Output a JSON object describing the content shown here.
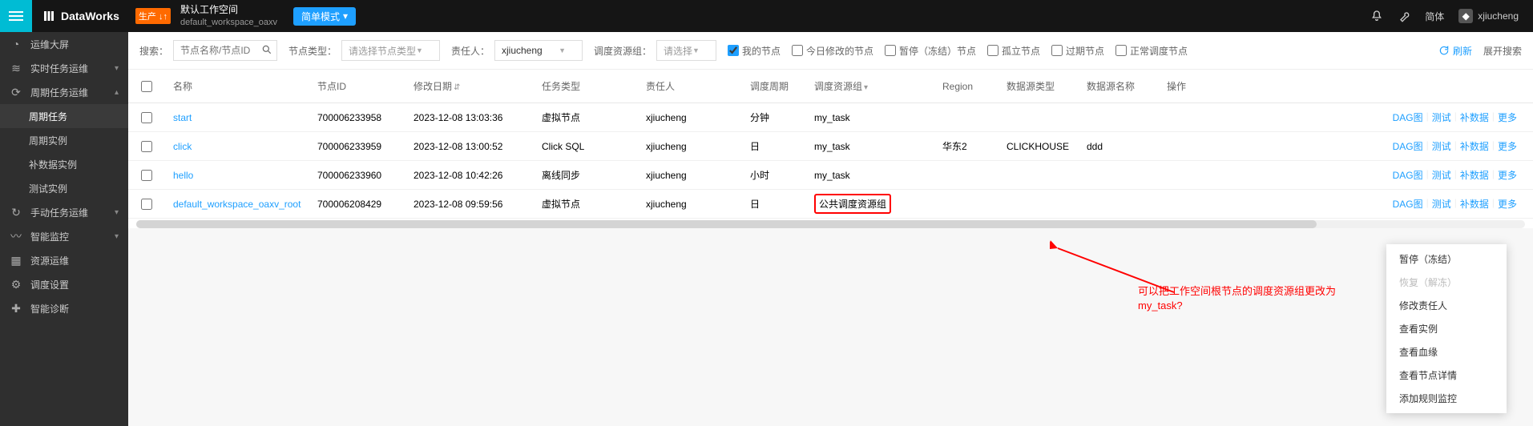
{
  "header": {
    "brand": "DataWorks",
    "prod_tag": "生产 ↓↑",
    "workspace_title": "默认工作空间",
    "workspace_sub": "default_workspace_oaxv",
    "mode_label": "简单模式",
    "lang_label": "简体",
    "username": "xjiucheng"
  },
  "sidebar": {
    "items": [
      {
        "icon": "dashboard",
        "label": "运维大屏",
        "chev": ""
      },
      {
        "icon": "realtime",
        "label": "实时任务运维",
        "chev": "down"
      },
      {
        "icon": "cycle",
        "label": "周期任务运维",
        "chev": "up"
      },
      {
        "icon": "",
        "label": "周期任务",
        "chev": "",
        "lv": 2,
        "active": true
      },
      {
        "icon": "",
        "label": "周期实例",
        "chev": "",
        "lv": 2
      },
      {
        "icon": "",
        "label": "补数据实例",
        "chev": "",
        "lv": 2
      },
      {
        "icon": "",
        "label": "测试实例",
        "chev": "",
        "lv": 2
      },
      {
        "icon": "manual",
        "label": "手动任务运维",
        "chev": "down"
      },
      {
        "icon": "monitor",
        "label": "智能监控",
        "chev": "down"
      },
      {
        "icon": "resource",
        "label": "资源运维",
        "chev": ""
      },
      {
        "icon": "settings",
        "label": "调度设置",
        "chev": ""
      },
      {
        "icon": "diagnose",
        "label": "智能诊断",
        "chev": ""
      }
    ]
  },
  "filter": {
    "search_label": "搜索：",
    "search_placeholder": "节点名称/节点ID",
    "node_type_label": "节点类型：",
    "node_type_placeholder": "请选择节点类型",
    "owner_label": "责任人：",
    "owner_value": "xjiucheng",
    "resgroup_label": "调度资源组：",
    "resgroup_placeholder": "请选择",
    "chk_mynode": "我的节点",
    "chk_today": "今日修改的节点",
    "chk_paused": "暂停（冻结）节点",
    "chk_isolated": "孤立节点",
    "chk_expired": "过期节点",
    "chk_normal": "正常调度节点",
    "refresh_label": "刷新",
    "expand_label": "展开搜索"
  },
  "table": {
    "headers": {
      "name": "名称",
      "id": "节点ID",
      "date": "修改日期",
      "type": "任务类型",
      "owner": "责任人",
      "cycle": "调度周期",
      "group": "调度资源组",
      "region": "Region",
      "dstype": "数据源类型",
      "dsname": "数据源名称",
      "ops": "操作"
    },
    "rows": [
      {
        "name": "start",
        "id": "700006233958",
        "date": "2023-12-08 13:03:36",
        "type": "虚拟节点",
        "owner": "xjiucheng",
        "cycle": "分钟",
        "group": "my_task",
        "region": "",
        "dstype": "",
        "dsname": ""
      },
      {
        "name": "click",
        "id": "700006233959",
        "date": "2023-12-08 13:00:52",
        "type": "Click SQL",
        "owner": "xjiucheng",
        "cycle": "日",
        "group": "my_task",
        "region": "华东2",
        "dstype": "CLICKHOUSE",
        "dsname": "ddd"
      },
      {
        "name": "hello",
        "id": "700006233960",
        "date": "2023-12-08 10:42:26",
        "type": "离线同步",
        "owner": "xjiucheng",
        "cycle": "小时",
        "group": "my_task",
        "region": "",
        "dstype": "",
        "dsname": ""
      },
      {
        "name": "default_workspace_oaxv_root",
        "id": "700006208429",
        "date": "2023-12-08 09:59:56",
        "type": "虚拟节点",
        "owner": "xjiucheng",
        "cycle": "日",
        "group": "公共调度资源组",
        "region": "",
        "dstype": "",
        "dsname": "",
        "highlight_group": true
      }
    ],
    "ops": {
      "dag": "DAG图",
      "test": "测试",
      "patch": "补数据",
      "more": "更多"
    }
  },
  "context_menu": [
    {
      "label": "暂停（冻结）"
    },
    {
      "label": "恢复（解冻）",
      "disabled": true
    },
    {
      "label": "修改责任人"
    },
    {
      "label": "查看实例"
    },
    {
      "label": "查看血缘"
    },
    {
      "label": "查看节点详情"
    },
    {
      "label": "添加规则监控"
    }
  ],
  "annotation": {
    "line1": "可以把工作空间根节点的调度资源组更改为",
    "line2": "my_task?"
  }
}
